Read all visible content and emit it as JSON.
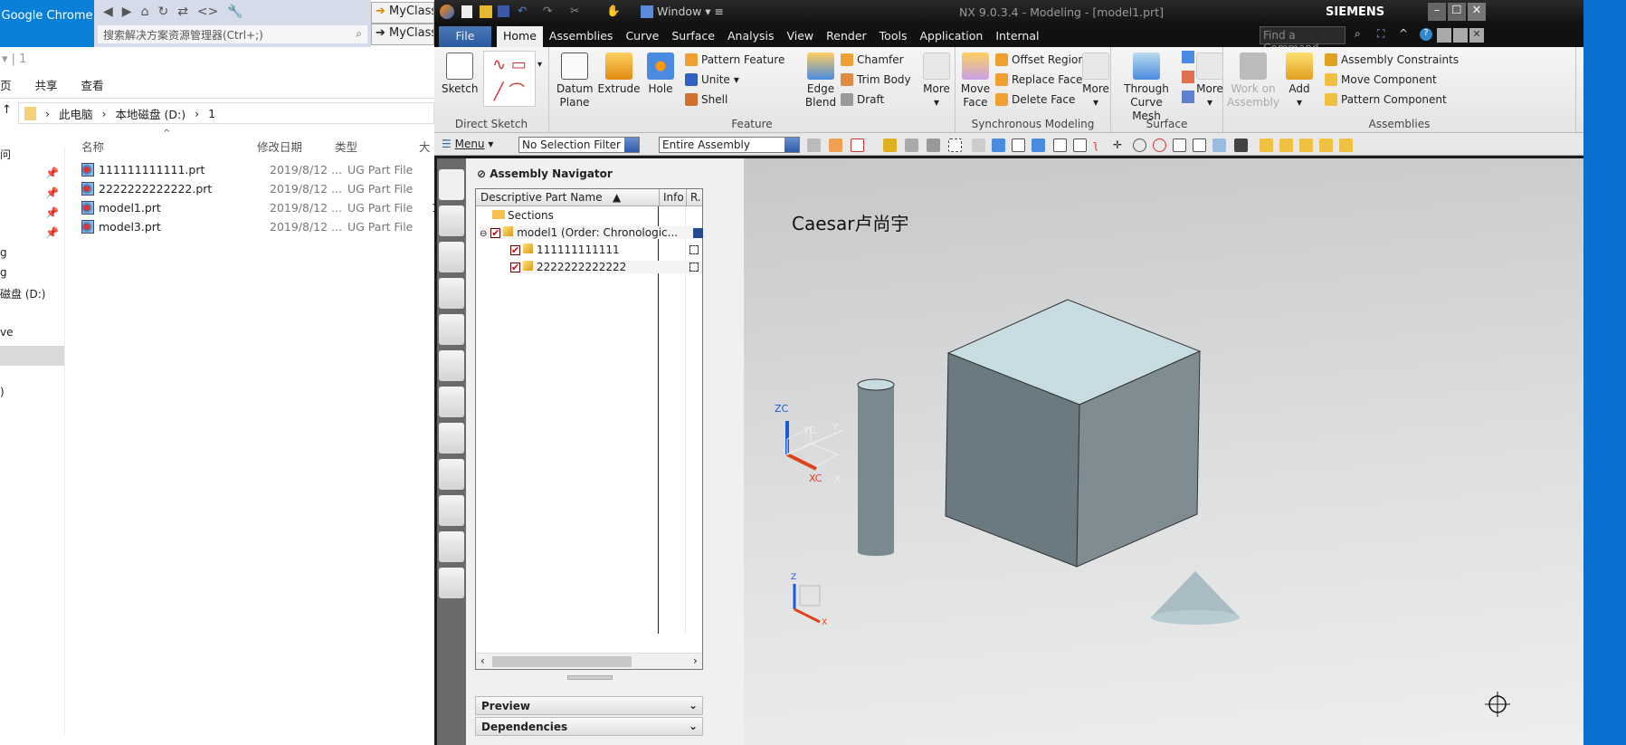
{
  "desktop": {
    "icon_label": "Google Chrome"
  },
  "vs": {
    "search_placeholder": "搜索解决方案资源管理器(Ctrl+;)",
    "tabs": [
      "MyClass",
      "MyClass"
    ]
  },
  "explorer": {
    "title": "1",
    "ribbon_tabs": [
      "页",
      "共享",
      "查看"
    ],
    "breadcrumb": [
      "此电脑",
      "本地磁盘 (D:)",
      "1"
    ],
    "columns": [
      "名称",
      "修改日期",
      "类型",
      "大"
    ],
    "files": [
      {
        "name": "111111111111.prt",
        "date": "2019/8/12 ...",
        "type": "UG Part File",
        "size": ""
      },
      {
        "name": "2222222222222.prt",
        "date": "2019/8/12 ...",
        "type": "UG Part File",
        "size": ""
      },
      {
        "name": "model1.prt",
        "date": "2019/8/12 ...",
        "type": "UG Part File",
        "size": "1("
      },
      {
        "name": "model3.prt",
        "date": "2019/8/12 ...",
        "type": "UG Part File",
        "size": ""
      }
    ],
    "nav_items": [
      "问",
      "",
      "",
      "",
      "",
      "g",
      "g",
      "磁盘 (D:)",
      "",
      "ve",
      "",
      "",
      ")"
    ]
  },
  "nx": {
    "quick_access_window": "Window",
    "title": "NX 9.0.3.4 - Modeling - [model1.prt]",
    "brand": "SIEMENS",
    "find_command_placeholder": "Find a Command",
    "tabs": [
      "File",
      "Home",
      "Assemblies",
      "Curve",
      "Surface",
      "Analysis",
      "View",
      "Render",
      "Tools",
      "Application",
      "Internal"
    ],
    "active_tab": "Home",
    "ribbon": {
      "direct_sketch": {
        "label": "Direct Sketch",
        "sketch": "Sketch"
      },
      "feature": {
        "label": "Feature",
        "datum_plane": "Datum Plane",
        "extrude": "Extrude",
        "hole": "Hole",
        "pattern_feature": "Pattern Feature",
        "unite": "Unite",
        "shell": "Shell",
        "edge_blend": "Edge Blend",
        "chamfer": "Chamfer",
        "trim_body": "Trim Body",
        "draft": "Draft",
        "more": "More"
      },
      "sync": {
        "label": "Synchronous Modeling",
        "move_face": "Move Face",
        "offset_region": "Offset Region",
        "replace_face": "Replace Face",
        "delete_face": "Delete Face",
        "more": "More"
      },
      "surface": {
        "label": "Surface",
        "through_curve_mesh": "Through Curve Mesh",
        "more": "More"
      },
      "assemblies": {
        "label": "Assemblies",
        "work_on_assembly": "Work on Assembly",
        "add": "Add",
        "assembly_constraints": "Assembly Constraints",
        "move_component": "Move Component",
        "pattern_component": "Pattern Component"
      }
    },
    "toolbar": {
      "menu": "Menu",
      "selection_filter": "No Selection Filter",
      "scope": "Entire Assembly"
    },
    "navigator": {
      "title": "Assembly Navigator",
      "columns": [
        "Descriptive Part Name",
        "Info",
        "R."
      ],
      "rows": [
        {
          "name": "Sections",
          "level": 0
        },
        {
          "name": "model1 (Order: Chronologic...",
          "level": 0
        },
        {
          "name": "111111111111",
          "level": 1
        },
        {
          "name": "2222222222222",
          "level": 1
        }
      ],
      "preview": "Preview",
      "dependencies": "Dependencies"
    },
    "viewport": {
      "annotation": "Caesar卢尚宇",
      "wcs_labels": {
        "zc": "ZC",
        "yc": "YC",
        "xc": "XC",
        "y": "Y",
        "x": "X",
        "z": "Z"
      },
      "colors": {
        "cube_top": "#c8dde2",
        "cube_left": "#6b7a80",
        "cube_right": "#7f8d92",
        "x_axis": "#e0401a",
        "z_axis": "#1a5ad8"
      }
    }
  }
}
